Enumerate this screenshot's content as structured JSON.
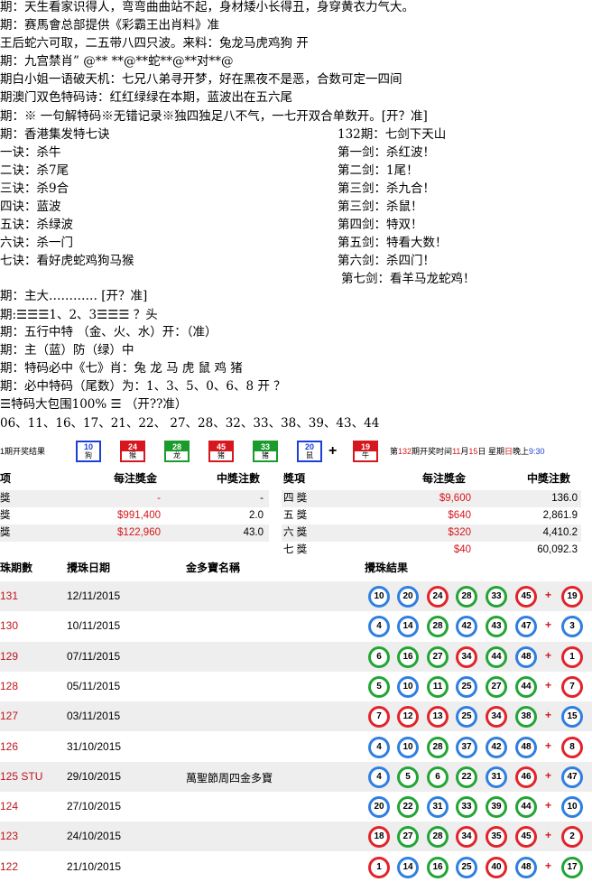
{
  "tips": {
    "lines": [
      "期：天生看家识得人，弯弯曲曲站不起，身材矮小长得丑，身穿黄衣力气大。",
      "期：赛馬會总部提供《彩霸王出肖料》准",
      "王后蛇六可取，二五带八四只波。来料：兔龙马虎鸡狗   开",
      "期：九宫禁肖” @** **@**蛇**@**对**@",
      "期白小姐一语破天机：七兄八弟寻开梦，好在黑夜不是恶，合数可定一四间",
      "期澳门双色特码诗：红红绿绿在本期，蓝波出在五六尾",
      "期：※ 一句解特码※无错记录※独四独足八不气，一七开双合单数开。[开？准]",
      "期：香港集发特七诀",
      "一诀：杀牛",
      "二诀：杀7尾",
      "三诀：杀9合",
      "四诀：蓝波",
      "五诀：杀绿波",
      "六诀：杀一门",
      "七诀：看好虎蛇鸡狗马猴",
      "期：主大………… [开？准]",
      "期:☰☰☰1、2、3☰☰☰ ？头",
      "期：五行中特 （金、火、水）开：（准）",
      "期：主（蓝）防（绿）中",
      "期：特码必中《七》肖：兔 龙 马 虎 鼠 鸡  猪",
      "期：必中特码（尾数）为：1、3、5、0、6、8     开 ？",
      "☰特码大包围100% ☰  （开??准）",
      " 06、11、16、17、21、22、 27、28、32、33、38、39、43、44"
    ],
    "sword": [
      "132期：七剑下天山",
      "第一剑：杀红波！",
      "第二剑：1尾！",
      "第三剑：杀九合！",
      "第三剑：杀鼠！",
      "第四剑：特双！",
      "第五剑：特看大数！",
      "第六剑：杀四门！",
      "第七剑：看羊马龙蛇鸡！"
    ]
  },
  "draw": {
    "label": "1期开奖结果",
    "tiles": [
      {
        "num": "10",
        "zodiac": "狗",
        "color": "blue"
      },
      {
        "num": "24",
        "zodiac": "猴",
        "color": "red"
      },
      {
        "num": "28",
        "zodiac": "龙",
        "color": "green"
      },
      {
        "num": "45",
        "zodiac": "猪",
        "color": "red"
      },
      {
        "num": "33",
        "zodiac": "猪",
        "color": "green"
      },
      {
        "num": "20",
        "zodiac": "鼠",
        "color": "blue"
      }
    ],
    "plus": "+",
    "special": {
      "num": "19",
      "zodiac": "牛",
      "color": "red"
    },
    "next_pre": "第",
    "next_period": "132",
    "next_mid": "期开奖时间",
    "next_month": "11",
    "next_m": "月",
    "next_day": "15",
    "next_d": "日 星期",
    "next_weekday": "日",
    "next_time_label": "晚上",
    "next_time": "9:30"
  },
  "prizes": {
    "headers": {
      "item": "项",
      "amount": "每注獎金",
      "count": "中獎注數",
      "item2": "獎項",
      "amount2": "每注獎金",
      "count2": "中獎注數"
    },
    "left": [
      {
        "name": "獎",
        "amount": "-",
        "count": "-"
      },
      {
        "name": "獎",
        "amount": "$991,400",
        "count": "2.0"
      },
      {
        "name": "獎",
        "amount": "$122,960",
        "count": "43.0"
      }
    ],
    "right": [
      {
        "name": "四 獎",
        "amount": "$9,600",
        "count": "136.0"
      },
      {
        "name": "五 獎",
        "amount": "$640",
        "count": "2,861.9"
      },
      {
        "name": "六 獎",
        "amount": "$320",
        "count": "4,410.2"
      },
      {
        "name": "七 獎",
        "amount": "$40",
        "count": "60,092.3"
      }
    ]
  },
  "history": {
    "headers": {
      "period": "珠期數",
      "date": "攪珠日期",
      "name": "金多寶名稱",
      "result": "攪珠結果"
    },
    "rows": [
      {
        "period": "131",
        "date": "12/11/2015",
        "name": "",
        "balls": [
          [
            "10",
            "blue"
          ],
          [
            "20",
            "blue"
          ],
          [
            "24",
            "red"
          ],
          [
            "28",
            "green"
          ],
          [
            "33",
            "green"
          ],
          [
            "45",
            "red"
          ]
        ],
        "special": [
          "19",
          "red"
        ]
      },
      {
        "period": "130",
        "date": "10/11/2015",
        "name": "",
        "balls": [
          [
            "4",
            "blue"
          ],
          [
            "14",
            "blue"
          ],
          [
            "28",
            "green"
          ],
          [
            "42",
            "blue"
          ],
          [
            "43",
            "green"
          ],
          [
            "47",
            "blue"
          ]
        ],
        "special": [
          "3",
          "blue"
        ]
      },
      {
        "period": "129",
        "date": "07/11/2015",
        "name": "",
        "balls": [
          [
            "6",
            "green"
          ],
          [
            "16",
            "green"
          ],
          [
            "27",
            "green"
          ],
          [
            "34",
            "red"
          ],
          [
            "44",
            "green"
          ],
          [
            "48",
            "blue"
          ]
        ],
        "special": [
          "1",
          "red"
        ]
      },
      {
        "period": "128",
        "date": "05/11/2015",
        "name": "",
        "balls": [
          [
            "5",
            "green"
          ],
          [
            "10",
            "blue"
          ],
          [
            "11",
            "green"
          ],
          [
            "25",
            "blue"
          ],
          [
            "27",
            "green"
          ],
          [
            "44",
            "green"
          ]
        ],
        "special": [
          "7",
          "red"
        ]
      },
      {
        "period": "127",
        "date": "03/11/2015",
        "name": "",
        "balls": [
          [
            "7",
            "red"
          ],
          [
            "12",
            "red"
          ],
          [
            "13",
            "red"
          ],
          [
            "25",
            "blue"
          ],
          [
            "34",
            "red"
          ],
          [
            "38",
            "green"
          ]
        ],
        "special": [
          "15",
          "blue"
        ]
      },
      {
        "period": "126",
        "date": "31/10/2015",
        "name": "",
        "balls": [
          [
            "4",
            "blue"
          ],
          [
            "10",
            "blue"
          ],
          [
            "28",
            "green"
          ],
          [
            "37",
            "blue"
          ],
          [
            "42",
            "blue"
          ],
          [
            "48",
            "blue"
          ]
        ],
        "special": [
          "8",
          "red"
        ]
      },
      {
        "period": "125 STU",
        "date": "29/10/2015",
        "name": "萬聖節周四金多寶",
        "balls": [
          [
            "4",
            "blue"
          ],
          [
            "5",
            "green"
          ],
          [
            "6",
            "green"
          ],
          [
            "22",
            "green"
          ],
          [
            "31",
            "blue"
          ],
          [
            "46",
            "red"
          ]
        ],
        "special": [
          "47",
          "blue"
        ]
      },
      {
        "period": "124",
        "date": "27/10/2015",
        "name": "",
        "balls": [
          [
            "20",
            "blue"
          ],
          [
            "22",
            "green"
          ],
          [
            "31",
            "blue"
          ],
          [
            "33",
            "green"
          ],
          [
            "39",
            "green"
          ],
          [
            "44",
            "green"
          ]
        ],
        "special": [
          "10",
          "blue"
        ]
      },
      {
        "period": "123",
        "date": "24/10/2015",
        "name": "",
        "balls": [
          [
            "18",
            "red"
          ],
          [
            "27",
            "green"
          ],
          [
            "28",
            "green"
          ],
          [
            "34",
            "red"
          ],
          [
            "35",
            "red"
          ],
          [
            "45",
            "red"
          ]
        ],
        "special": [
          "2",
          "red"
        ]
      },
      {
        "period": "122",
        "date": "21/10/2015",
        "name": "",
        "balls": [
          [
            "1",
            "red"
          ],
          [
            "14",
            "blue"
          ],
          [
            "16",
            "green"
          ],
          [
            "25",
            "blue"
          ],
          [
            "40",
            "red"
          ],
          [
            "48",
            "blue"
          ]
        ],
        "special": [
          "17",
          "green"
        ]
      }
    ],
    "plus": "+"
  },
  "colors": {
    "red": "#e2232a",
    "blue": "#2f7fe0",
    "green": "#22a534",
    "period_red": "#c0141b"
  }
}
